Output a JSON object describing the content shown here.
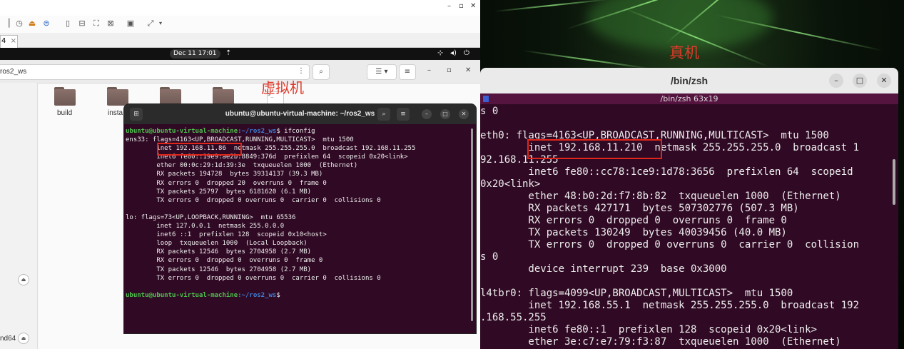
{
  "vm_window": {
    "tab_label": "4",
    "tab_close": "×",
    "clock": "Dec 11  17:01",
    "path": "ros2_ws",
    "folders": [
      "build",
      "insta"
    ],
    "sidebar_bottom_label": "nd64",
    "annotation": "虚拟机"
  },
  "vm_terminal": {
    "title": "ubuntu@ubuntu-virtual-machine: ~/ros2_ws",
    "prompt_user": "ubuntu@ubuntu-virtual-machine",
    "prompt_path": ":~/ros2_ws",
    "command": "$ ifconfig",
    "output": [
      "ens33: flags=4163<UP,BROADCAST,RUNNING,MULTICAST>  mtu 1500",
      "        inet 192.168.11.86  netmask 255.255.255.0  broadcast 192.168.11.255",
      "        inet6 fe80::19e9:ae2b:8849:376d  prefixlen 64  scopeid 0x20<link>",
      "        ether 00:0c:29:1d:39:3e  txqueuelen 1000  (Ethernet)",
      "        RX packets 194728  bytes 39314137 (39.3 MB)",
      "        RX errors 0  dropped 20  overruns 0  frame 0",
      "        TX packets 25797  bytes 6181620 (6.1 MB)",
      "        TX errors 0  dropped 0 overruns 0  carrier 0  collisions 0",
      "",
      "lo: flags=73<UP,LOOPBACK,RUNNING>  mtu 65536",
      "        inet 127.0.0.1  netmask 255.0.0.0",
      "        inet6 ::1  prefixlen 128  scopeid 0x10<host>",
      "        loop  txqueuelen 1000  (Local Loopback)",
      "        RX packets 12546  bytes 2704958 (2.7 MB)",
      "        RX errors 0  dropped 0  overruns 0  frame 0",
      "        TX packets 12546  bytes 2704958 (2.7 MB)",
      "        TX errors 0  dropped 0 overruns 0  carrier 0  collisions 0",
      ""
    ],
    "final_prompt_suffix": "$"
  },
  "real_machine": {
    "annotation": "真机",
    "window_title": "/bin/zsh",
    "tab_title": "/bin/zsh 63x19",
    "output": [
      "s 0",
      "",
      "eth0: flags=4163<UP,BROADCAST,RUNNING,MULTICAST>  mtu 1500",
      "        inet 192.168.11.210  netmask 255.255.255.0  broadcast 1",
      "92.168.11.255",
      "        inet6 fe80::cc78:1ce9:1d78:3656  prefixlen 64  scopeid",
      "0x20<link>",
      "        ether 48:b0:2d:f7:8b:82  txqueuelen 1000  (Ethernet)",
      "        RX packets 427171  bytes 507302776 (507.3 MB)",
      "        RX errors 0  dropped 0  overruns 0  frame 0",
      "        TX packets 130249  bytes 40039456 (40.0 MB)",
      "        TX errors 0  dropped 0 overruns 0  carrier 0  collision",
      "s 0",
      "        device interrupt 239  base 0x3000",
      "",
      "l4tbr0: flags=4099<UP,BROADCAST,MULTICAST>  mtu 1500",
      "        inet 192.168.55.1  netmask 255.255.255.0  broadcast 192",
      ".168.55.255",
      "        inet6 fe80::1  prefixlen 128  scopeid 0x20<link>",
      "        ether 3e:c7:e7:79:f3:87  txqueuelen 1000  (Ethernet)"
    ]
  },
  "colors": {
    "terminal_bg": "#300a24",
    "highlight": "#e0261a",
    "prompt_user": "#4ec24e",
    "prompt_path": "#3f7fd6"
  }
}
